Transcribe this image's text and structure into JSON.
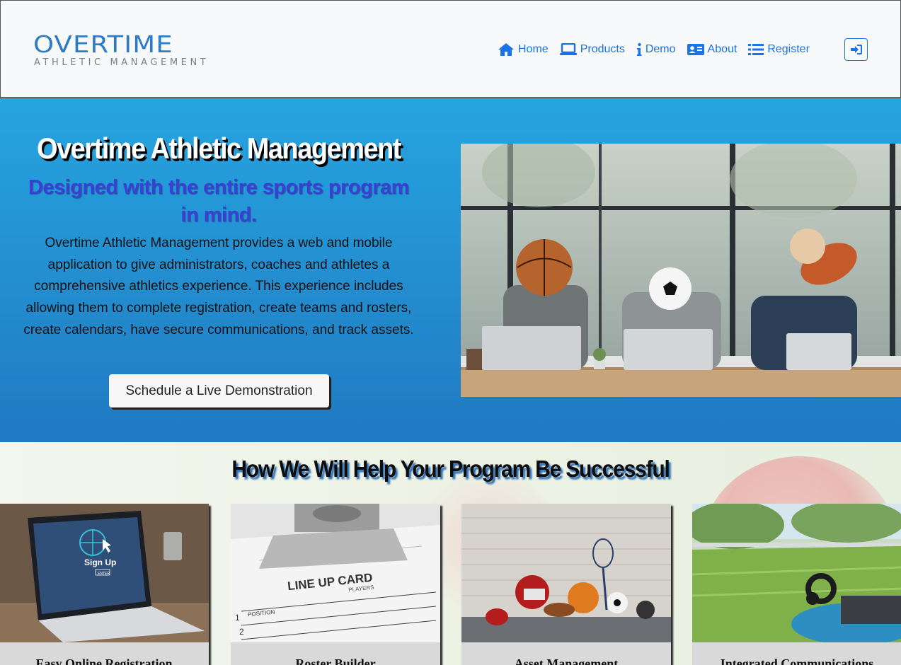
{
  "logo": {
    "main": "OVERTIME",
    "sub": "ATHLETIC MANAGEMENT"
  },
  "nav": {
    "items": [
      {
        "label": "Home",
        "icon": "home-icon"
      },
      {
        "label": "Products",
        "icon": "laptop-icon"
      },
      {
        "label": "Demo",
        "icon": "info-icon"
      },
      {
        "label": "About",
        "icon": "id-card-icon"
      },
      {
        "label": "Register",
        "icon": "list-icon"
      }
    ],
    "login_icon": "sign-in-icon"
  },
  "hero": {
    "title": "Overtime Athletic Management",
    "subtitle": "Designed with the entire sports program in mind.",
    "body": "Overtime Athletic Management provides a web and mobile application to give administrators, coaches and athletes a comprehensive athletics experience. This experience includes allowing them to complete registration, create teams and rosters, create calendars, have secure communications, and track assets.",
    "button": "Schedule a Live Demonstration"
  },
  "features": {
    "title": "How We Will Help Your Program Be Successful",
    "cards": [
      {
        "label": "Easy Online Registration",
        "image_text": "Sign Up",
        "image_text2": "ENTER"
      },
      {
        "label": "Roster Builder",
        "image_text": "LINE UP CARD",
        "image_text2": "PLAYERS",
        "image_text3": "POSITION",
        "image_text4": "1",
        "image_text5": "2"
      },
      {
        "label": "Asset Management"
      },
      {
        "label": "Integrated Communications"
      }
    ]
  },
  "colors": {
    "nav_link": "#1a73e8",
    "hero_top": "#26a5df",
    "hero_bottom": "#2079c2",
    "subtitle": "#3b3fd6",
    "logo": "#2b7bc7"
  }
}
